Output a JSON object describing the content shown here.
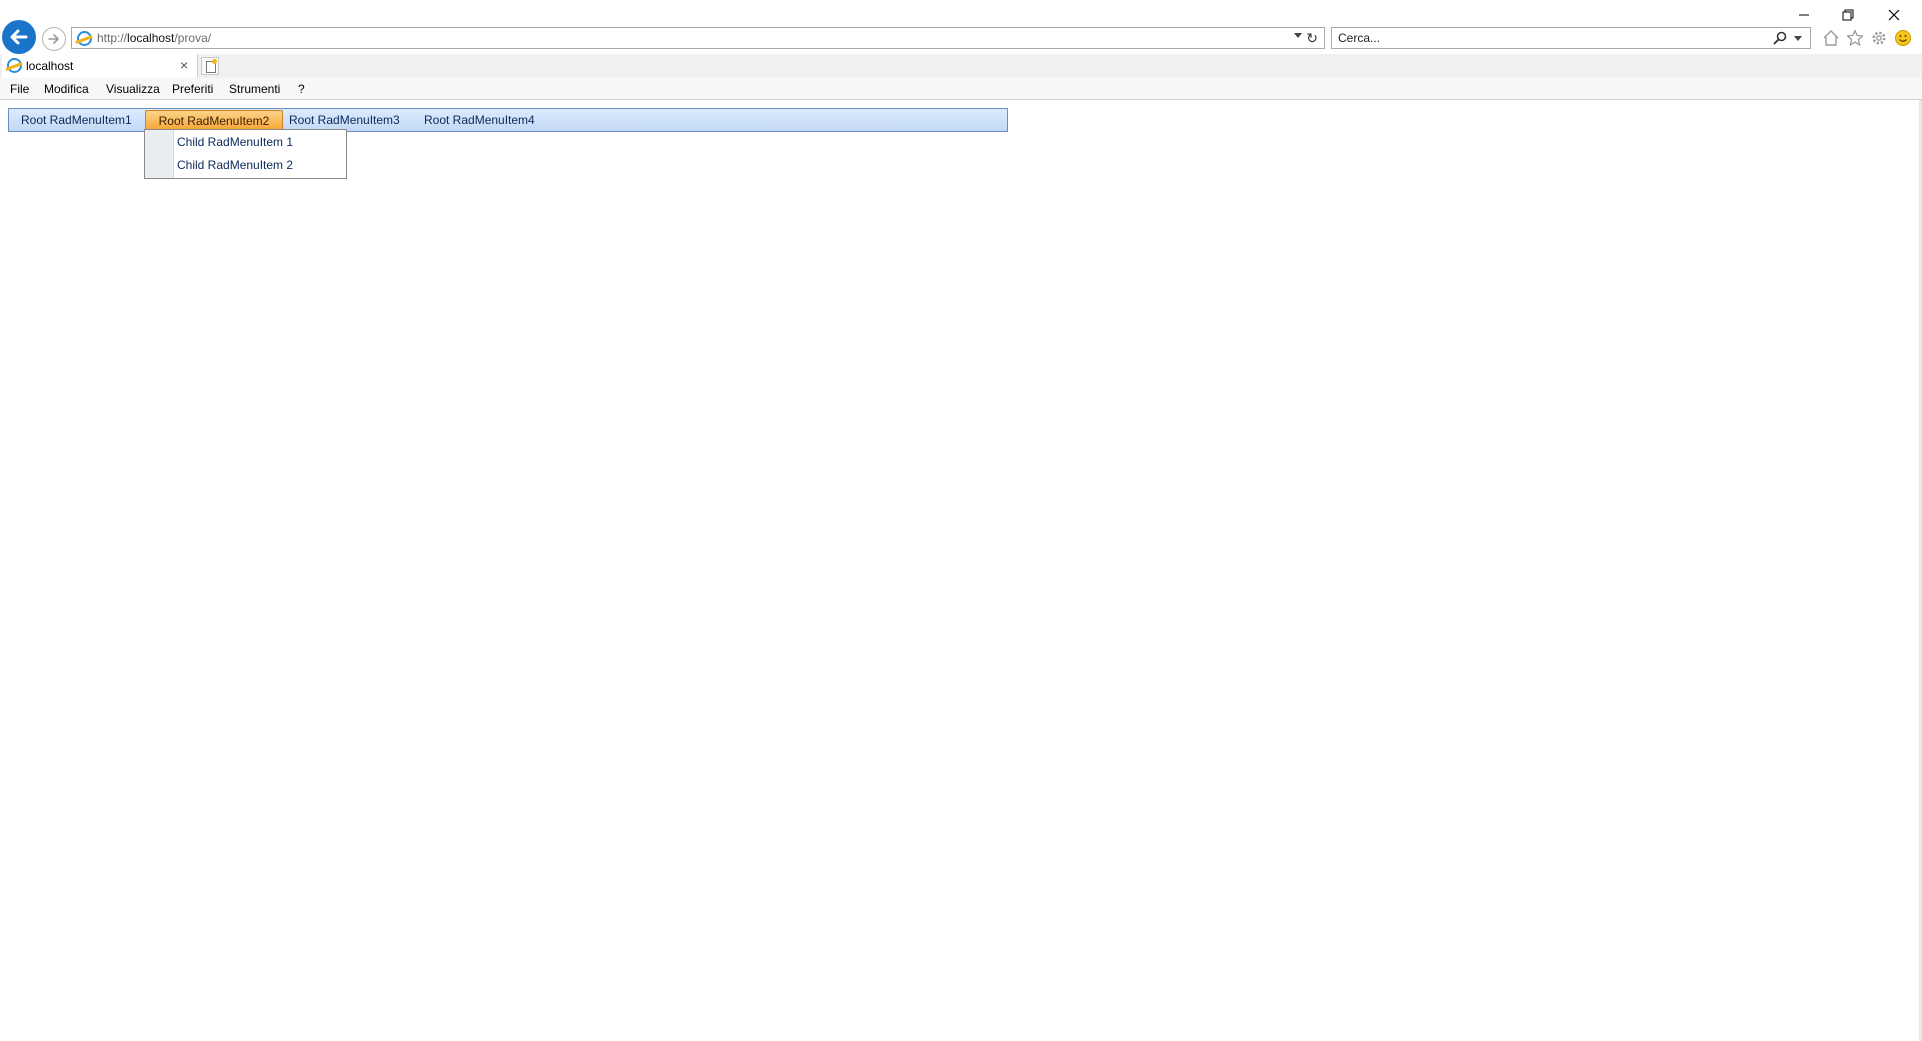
{
  "browser": {
    "address_url_prefix": "http://",
    "address_url_host": "localhost",
    "address_url_path": "/prova/",
    "search_placeholder": "Cerca...",
    "tab_title": "localhost",
    "tab_close": "×",
    "refresh_glyph": "↻"
  },
  "menu_bar": {
    "file": "File",
    "modifica": "Modifica",
    "visualizza": "Visualizza",
    "preferiti": "Preferiti",
    "strumenti": "Strumenti",
    "help": "?"
  },
  "rad_menu": {
    "items": [
      {
        "label": "Root RadMenuItem1"
      },
      {
        "label": "Root RadMenuItem2"
      },
      {
        "label": "Root RadMenuItem3"
      },
      {
        "label": "Root RadMenuItem4"
      }
    ],
    "open_item_index": 1,
    "children": [
      {
        "label": "Child RadMenuItem 1"
      },
      {
        "label": "Child RadMenuItem 2"
      }
    ]
  },
  "colors": {
    "back_button": "#1a74c9",
    "menu_gradient_top": "#dcebfc",
    "menu_gradient_bottom": "#c2d9f6",
    "active_item_top": "#fcd38a",
    "active_item_bottom": "#f6a83a"
  },
  "icons": [
    "back-arrow-icon",
    "forward-arrow-icon",
    "ie-logo-icon",
    "refresh-icon",
    "search-icon",
    "home-icon",
    "star-icon",
    "gear-icon",
    "smiley-icon",
    "minimize-icon",
    "restore-icon",
    "close-icon"
  ]
}
